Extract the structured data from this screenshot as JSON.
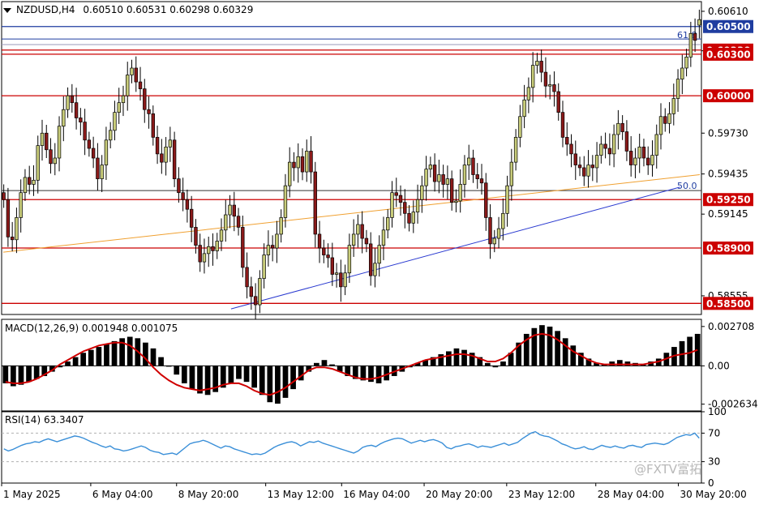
{
  "header": {
    "symbol": "NZDUSD,H4",
    "ohlc": "0.60510 0.60531 0.60298 0.60329"
  },
  "watermark": "@FXTV富拓",
  "colors": {
    "up_candle": "#c8cc7a",
    "down_candle": "#8b1a1a",
    "support_lines": "#cc0000",
    "blue_line": "#1f3da0",
    "trend_orange": "#f0a030",
    "trend_blue": "#2a3ad0",
    "macd_signal": "#d00000",
    "rsi_line": "#3a8fd8"
  },
  "chart_data": [
    {
      "type": "candlestick",
      "title": "NZDUSD,H4",
      "ylim": [
        0.5842,
        0.6068
      ],
      "price_labels": [
        "0.60610",
        "0.60325",
        "0.59730",
        "0.59435",
        "0.59145",
        "0.58555"
      ],
      "price_label_values": [
        0.6061,
        0.60325,
        0.5973,
        0.59435,
        0.59145,
        0.58555
      ],
      "x_labels": [
        "1 May 2025",
        "6 May 04:00",
        "8 May 20:00",
        "13 May 12:00",
        "16 May 04:00",
        "20 May 20:00",
        "23 May 12:00",
        "28 May 04:00",
        "30 May 20:00"
      ],
      "x_label_bars": [
        0,
        27,
        53,
        80,
        103,
        128,
        153,
        180,
        205
      ],
      "horizontal_levels": [
        {
          "label": "0.60500",
          "value": 0.605,
          "color": "#1f3da0",
          "tag_color": "#1f3da0"
        },
        {
          "label": "0.60330",
          "value": 0.6033,
          "color": "#cc0000",
          "tag_color": "#cc0000"
        },
        {
          "label": "0.60300",
          "value": 0.603,
          "color": "#cc0000",
          "tag_color": "#cc0000"
        },
        {
          "label": "0.60000",
          "value": 0.6,
          "color": "#cc0000",
          "tag_color": "#cc0000"
        },
        {
          "label": "0.59250",
          "value": 0.5925,
          "color": "#cc0000",
          "tag_color": "#cc0000"
        },
        {
          "label": "0.58900",
          "value": 0.589,
          "color": "#cc0000",
          "tag_color": "#cc0000"
        },
        {
          "label": "0.58500",
          "value": 0.585,
          "color": "#cc0000",
          "tag_color": "#cc0000"
        }
      ],
      "extra_levels": [
        {
          "value": 0.6041,
          "color": "#1f3da0"
        },
        {
          "value": 0.6037,
          "color": "#9a9ab8"
        },
        {
          "value": 0.59315,
          "color": "#333333"
        }
      ],
      "fib_labels": [
        "61.8",
        "50.0"
      ],
      "fib_label_values": [
        0.6044,
        0.5935
      ],
      "trendlines": [
        {
          "name": "orange",
          "from": [
            0,
            0.5887
          ],
          "to": [
            211,
            0.5943
          ]
        },
        {
          "name": "blue",
          "from": [
            69,
            0.5846
          ],
          "to": [
            205,
            0.5934
          ]
        }
      ],
      "closes": [
        0.5925,
        0.5898,
        0.5896,
        0.5912,
        0.593,
        0.5941,
        0.5936,
        0.5939,
        0.5964,
        0.5973,
        0.5961,
        0.5951,
        0.5955,
        0.5978,
        0.599,
        0.6,
        0.5995,
        0.5984,
        0.5981,
        0.5968,
        0.5962,
        0.5955,
        0.594,
        0.595,
        0.5968,
        0.5975,
        0.5988,
        0.5995,
        0.6,
        0.6015,
        0.602,
        0.601,
        0.6005,
        0.599,
        0.5987,
        0.597,
        0.5958,
        0.5952,
        0.5963,
        0.5968,
        0.594,
        0.593,
        0.5925,
        0.5918,
        0.5905,
        0.5892,
        0.588,
        0.5886,
        0.5891,
        0.5888,
        0.5895,
        0.5903,
        0.5914,
        0.5921,
        0.5913,
        0.5905,
        0.5876,
        0.5862,
        0.5855,
        0.5849,
        0.5868,
        0.5885,
        0.5892,
        0.589,
        0.59,
        0.5912,
        0.5935,
        0.5952,
        0.5948,
        0.5956,
        0.5945,
        0.596,
        0.5945,
        0.59,
        0.589,
        0.5885,
        0.5883,
        0.5871,
        0.5872,
        0.5862,
        0.5872,
        0.5892,
        0.59,
        0.5907,
        0.5897,
        0.5893,
        0.587,
        0.5879,
        0.5892,
        0.5903,
        0.5912,
        0.593,
        0.5928,
        0.5923,
        0.5915,
        0.5908,
        0.5916,
        0.5925,
        0.5935,
        0.5947,
        0.595,
        0.5938,
        0.5943,
        0.5936,
        0.594,
        0.5923,
        0.5924,
        0.5936,
        0.595,
        0.5955,
        0.5943,
        0.594,
        0.5937,
        0.5912,
        0.5893,
        0.5897,
        0.5904,
        0.5915,
        0.5935,
        0.5952,
        0.597,
        0.5985,
        0.5997,
        0.6006,
        0.6022,
        0.6025,
        0.6017,
        0.6007,
        0.6008,
        0.6003,
        0.5988,
        0.597,
        0.5965,
        0.5958,
        0.595,
        0.5948,
        0.5942,
        0.595,
        0.5948,
        0.5957,
        0.5965,
        0.5962,
        0.5958,
        0.5972,
        0.598,
        0.5974,
        0.596,
        0.595,
        0.5955,
        0.5963,
        0.5955,
        0.595,
        0.5957,
        0.5972,
        0.5985,
        0.598,
        0.5987,
        0.5998,
        0.6012,
        0.602,
        0.6028,
        0.6045,
        0.604,
        0.6055
      ],
      "opens": [
        0.593,
        0.5925,
        0.5898,
        0.5896,
        0.5912,
        0.593,
        0.5941,
        0.5936,
        0.5939,
        0.5964,
        0.5973,
        0.5961,
        0.5951,
        0.5955,
        0.5978,
        0.599,
        0.6,
        0.5995,
        0.5984,
        0.5981,
        0.5968,
        0.5962,
        0.5955,
        0.594,
        0.595,
        0.5968,
        0.5975,
        0.5988,
        0.5995,
        0.6,
        0.6015,
        0.602,
        0.601,
        0.6005,
        0.599,
        0.5987,
        0.597,
        0.5958,
        0.5952,
        0.5963,
        0.5968,
        0.594,
        0.593,
        0.5925,
        0.5918,
        0.5905,
        0.5892,
        0.588,
        0.5886,
        0.5891,
        0.5888,
        0.5895,
        0.5903,
        0.5914,
        0.5921,
        0.5913,
        0.5905,
        0.5876,
        0.5862,
        0.5855,
        0.5849,
        0.5868,
        0.5885,
        0.5892,
        0.589,
        0.59,
        0.5912,
        0.5935,
        0.5952,
        0.5948,
        0.5956,
        0.5945,
        0.596,
        0.5945,
        0.59,
        0.589,
        0.5885,
        0.5883,
        0.5871,
        0.5872,
        0.5862,
        0.5872,
        0.5892,
        0.59,
        0.5907,
        0.5897,
        0.5893,
        0.587,
        0.5879,
        0.5892,
        0.5903,
        0.5912,
        0.593,
        0.5928,
        0.5923,
        0.5915,
        0.5908,
        0.5916,
        0.5925,
        0.5935,
        0.5947,
        0.595,
        0.5938,
        0.5943,
        0.5936,
        0.594,
        0.5923,
        0.5924,
        0.5936,
        0.595,
        0.5955,
        0.5943,
        0.594,
        0.5937,
        0.5912,
        0.5893,
        0.5897,
        0.5904,
        0.5915,
        0.5935,
        0.5952,
        0.597,
        0.5985,
        0.5997,
        0.6006,
        0.6022,
        0.6025,
        0.6017,
        0.6007,
        0.6008,
        0.6003,
        0.5988,
        0.597,
        0.5965,
        0.5958,
        0.595,
        0.5948,
        0.5942,
        0.595,
        0.5948,
        0.5957,
        0.5965,
        0.5962,
        0.5958,
        0.5972,
        0.598,
        0.5974,
        0.596,
        0.595,
        0.5955,
        0.5963,
        0.5955,
        0.595,
        0.5957,
        0.5972,
        0.5985,
        0.598,
        0.5987,
        0.5998,
        0.6012,
        0.602,
        0.6028,
        0.6045,
        0.6051
      ]
    },
    {
      "type": "bar",
      "title": "MACD(12,26,9) 0.001948 0.001075",
      "ylim": [
        -0.0031,
        0.0032
      ],
      "y_labels": [
        "0.002708",
        "0.00",
        "-0.002634"
      ],
      "y_label_values": [
        0.002708,
        0.0,
        -0.002634
      ],
      "histogram": [
        -0.0012,
        -0.0014,
        -0.0013,
        -0.0011,
        -0.0009,
        -0.0007,
        -0.0004,
        -0.0001,
        0.0003,
        0.0006,
        0.0009,
        0.0011,
        0.0013,
        0.0015,
        0.0017,
        0.0019,
        0.002,
        0.0019,
        0.0016,
        0.0012,
        0.0006,
        0.0,
        -0.0006,
        -0.0012,
        -0.0016,
        -0.0019,
        -0.002,
        -0.0018,
        -0.0015,
        -0.0012,
        -0.0009,
        -0.0011,
        -0.0015,
        -0.002,
        -0.0025,
        -0.0026,
        -0.0022,
        -0.0016,
        -0.001,
        -0.0004,
        0.0002,
        0.0004,
        0.0001,
        -0.0004,
        -0.0007,
        -0.0009,
        -0.001,
        -0.0011,
        -0.0012,
        -0.001,
        -0.0007,
        -0.0004,
        -0.0001,
        0.0002,
        0.0004,
        0.0006,
        0.0008,
        0.001,
        0.0012,
        0.0011,
        0.0009,
        0.0006,
        0.0002,
        -0.0001,
        0.0003,
        0.0009,
        0.0016,
        0.0022,
        0.0026,
        0.0028,
        0.0027,
        0.0024,
        0.0019,
        0.0014,
        0.0009,
        0.0005,
        0.0002,
        0.0001,
        0.0003,
        0.0004,
        0.0003,
        0.0002,
        0.0001,
        0.0003,
        0.0005,
        0.0009,
        0.0013,
        0.0017,
        0.002,
        0.0022
      ],
      "signal": [
        -0.0011,
        -0.0012,
        -0.0012,
        -0.0011,
        -0.0009,
        -0.0006,
        -0.0003,
        0.0001,
        0.0004,
        0.0007,
        0.001,
        0.0012,
        0.0014,
        0.0015,
        0.0016,
        0.0016,
        0.0014,
        0.001,
        0.0005,
        -0.0001,
        -0.0006,
        -0.001,
        -0.0013,
        -0.0015,
        -0.0016,
        -0.0017,
        -0.0016,
        -0.0015,
        -0.0013,
        -0.0012,
        -0.0012,
        -0.0014,
        -0.0017,
        -0.0019,
        -0.002,
        -0.0018,
        -0.0015,
        -0.0011,
        -0.0007,
        -0.0003,
        -0.0001,
        -0.0001,
        -0.0002,
        -0.0004,
        -0.0006,
        -0.0008,
        -0.0009,
        -0.0009,
        -0.0008,
        -0.0006,
        -0.0004,
        -0.0002,
        0.0,
        0.0002,
        0.0004,
        0.0005,
        0.0006,
        0.0007,
        0.0008,
        0.0008,
        0.0007,
        0.0005,
        0.0003,
        0.0003,
        0.0005,
        0.0009,
        0.0014,
        0.0018,
        0.0021,
        0.0022,
        0.0021,
        0.0018,
        0.0014,
        0.001,
        0.0007,
        0.0004,
        0.0002,
        0.0001,
        0.0001,
        0.0001,
        0.0001,
        0.0001,
        0.0001,
        0.0002,
        0.0003,
        0.0005,
        0.0007,
        0.0008,
        0.0009,
        0.0011
      ]
    },
    {
      "type": "line",
      "title": "RSI(14) 63.3407",
      "ylim": [
        0,
        100
      ],
      "y_labels": [
        "100",
        "70",
        "30",
        "0"
      ],
      "y_label_values": [
        100,
        70,
        30,
        0
      ],
      "levels": [
        70,
        30
      ],
      "values": [
        48,
        45,
        47,
        50,
        53,
        55,
        56,
        58,
        57,
        60,
        62,
        60,
        58,
        60,
        62,
        64,
        66,
        65,
        63,
        60,
        57,
        55,
        52,
        50,
        52,
        48,
        47,
        45,
        46,
        48,
        50,
        52,
        50,
        46,
        44,
        43,
        40,
        41,
        42,
        40,
        45,
        50,
        55,
        57,
        58,
        60,
        58,
        55,
        52,
        49,
        52,
        51,
        48,
        46,
        44,
        42,
        40,
        41,
        40,
        42,
        46,
        50,
        53,
        55,
        57,
        58,
        56,
        52,
        55,
        58,
        57,
        59,
        56,
        54,
        52,
        50,
        48,
        46,
        44,
        42,
        45,
        50,
        52,
        53,
        51,
        55,
        58,
        60,
        62,
        63,
        62,
        59,
        56,
        58,
        60,
        58,
        60,
        61,
        59,
        56,
        50,
        48,
        51,
        52,
        54,
        55,
        53,
        50,
        52,
        51,
        50,
        52,
        54,
        56,
        53,
        55,
        57,
        62,
        66,
        70,
        72,
        68,
        66,
        65,
        62,
        59,
        55,
        53,
        50,
        48,
        49,
        51,
        48,
        47,
        50,
        53,
        51,
        50,
        52,
        50,
        49,
        52,
        53,
        51,
        50,
        54,
        55,
        56,
        55,
        54,
        56,
        60,
        64,
        66,
        68,
        67,
        70,
        63
      ]
    }
  ]
}
